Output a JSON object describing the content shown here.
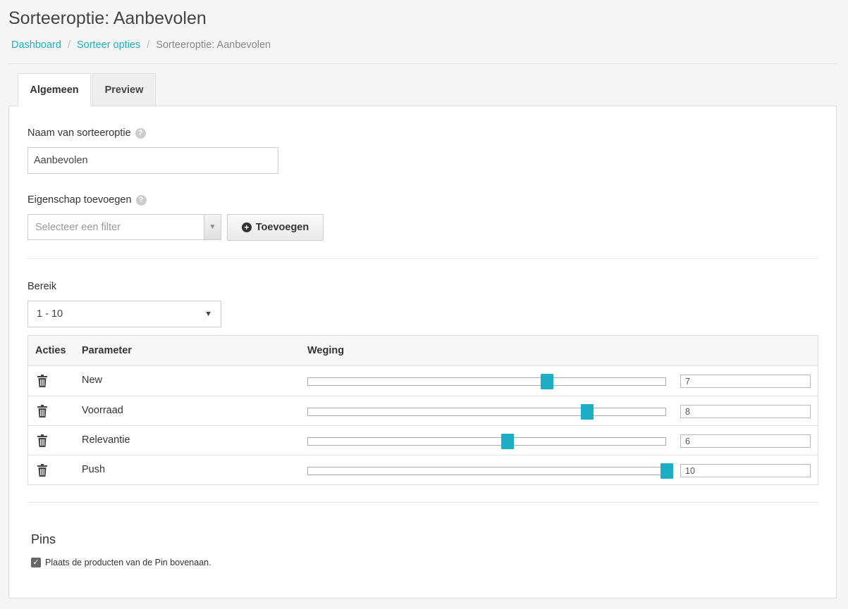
{
  "page": {
    "title": "Sorteeroptie: Aanbevolen"
  },
  "breadcrumb": {
    "items": [
      "Dashboard",
      "Sorteer opties"
    ],
    "separator": "/",
    "current": "Sorteeroptie: Aanbevolen"
  },
  "tabs": [
    {
      "label": "Algemeen",
      "active": true
    },
    {
      "label": "Preview",
      "active": false
    }
  ],
  "form": {
    "name_label": "Naam van sorteeroptie",
    "name_value": "Aanbevolen",
    "property_label": "Eigenschap toevoegen",
    "filter_placeholder": "Selecteer een filter",
    "add_button": "Toevoegen",
    "range_label": "Bereik",
    "range_value": "1 - 10",
    "help_icon": "?"
  },
  "table": {
    "headers": {
      "actions": "Acties",
      "parameter": "Parameter",
      "weight": "Weging"
    },
    "range": {
      "min": 1,
      "max": 10
    },
    "rows": [
      {
        "name": "New",
        "value": "7"
      },
      {
        "name": "Voorraad",
        "value": "8"
      },
      {
        "name": "Relevantie",
        "value": "6"
      },
      {
        "name": "Push",
        "value": "10"
      }
    ]
  },
  "pins": {
    "title": "Pins",
    "checkbox_label": "Plaats de producten van de Pin bovenaan.",
    "checked": true
  },
  "colors": {
    "accent": "#1eaec4",
    "link": "#1eaec4"
  },
  "icons": {
    "trash": "trash-icon",
    "plus": "plus-circle-icon",
    "help": "help-icon",
    "caret": "caret-down-icon",
    "check": "checkmark-icon"
  }
}
